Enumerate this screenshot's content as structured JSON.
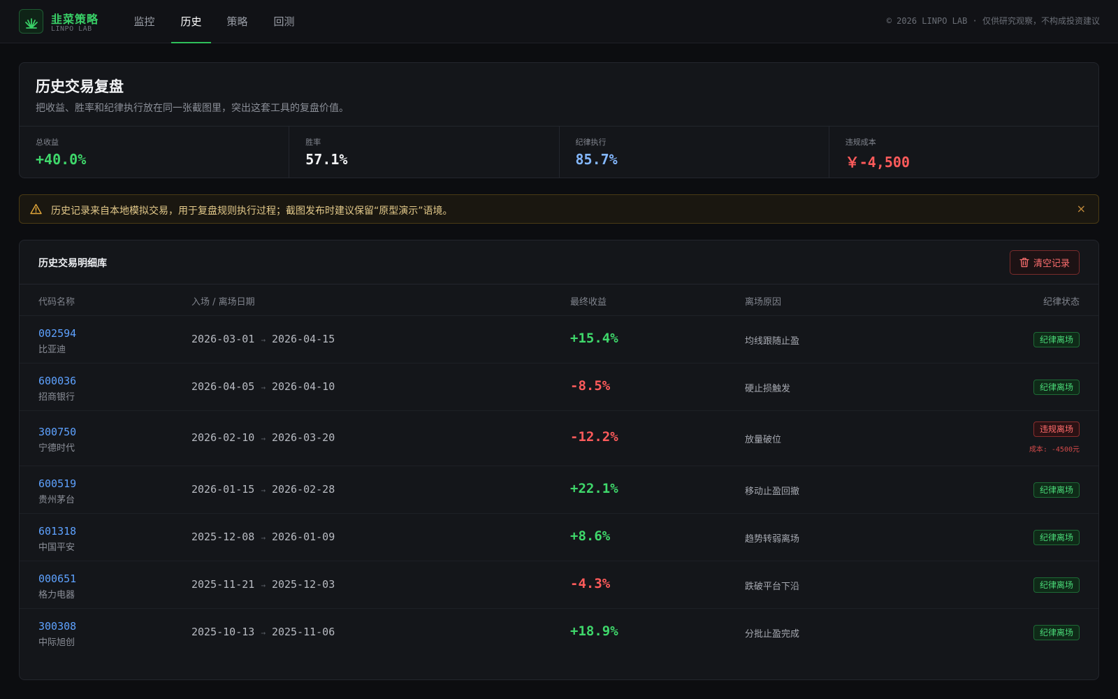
{
  "brand": {
    "name": "韭菜策略",
    "sub": "LINPO LAB"
  },
  "nav": [
    {
      "label": "监控",
      "active": false
    },
    {
      "label": "历史",
      "active": true
    },
    {
      "label": "策略",
      "active": false
    },
    {
      "label": "回测",
      "active": false
    }
  ],
  "top_notice": "© 2026 LINPO LAB · 仅供研究观察，不构成投资建议",
  "summary": {
    "title": "历史交易复盘",
    "desc": "把收益、胜率和纪律执行放在同一张截图里，突出这套工具的复盘价值。",
    "stats": [
      {
        "label": "总收益",
        "value": "+40.0%"
      },
      {
        "label": "胜率",
        "value": "57.1%"
      },
      {
        "label": "纪律执行",
        "value": "85.7%"
      },
      {
        "label": "违规成本",
        "value": "￥-4,500"
      }
    ]
  },
  "warning": {
    "text": "历史记录来自本地模拟交易，用于复盘规则执行过程；截图发布时建议保留“原型演示”语境。",
    "close": "×"
  },
  "table": {
    "title": "历史交易明细库",
    "clear_label": "清空记录",
    "columns": [
      "代码名称",
      "入场 / 离场日期",
      "最终收益",
      "离场原因",
      "纪律状态"
    ],
    "rows": [
      {
        "code": "002594",
        "name": "比亚迪",
        "entry": "2026-03-01",
        "exit": "2026-04-15",
        "pnl": "+15.4%",
        "reason": "均线跟随止盈",
        "status": "纪律离场",
        "status_ok": true,
        "cost": ""
      },
      {
        "code": "600036",
        "name": "招商银行",
        "entry": "2026-04-05",
        "exit": "2026-04-10",
        "pnl": "-8.5%",
        "reason": "硬止损触发",
        "status": "纪律离场",
        "status_ok": true,
        "cost": ""
      },
      {
        "code": "300750",
        "name": "宁德时代",
        "entry": "2026-02-10",
        "exit": "2026-03-20",
        "pnl": "-12.2%",
        "reason": "放量破位",
        "status": "违规离场",
        "status_ok": false,
        "cost": "成本: -4500元"
      },
      {
        "code": "600519",
        "name": "贵州茅台",
        "entry": "2026-01-15",
        "exit": "2026-02-28",
        "pnl": "+22.1%",
        "reason": "移动止盈回撤",
        "status": "纪律离场",
        "status_ok": true,
        "cost": ""
      },
      {
        "code": "601318",
        "name": "中国平安",
        "entry": "2025-12-08",
        "exit": "2026-01-09",
        "pnl": "+8.6%",
        "reason": "趋势转弱离场",
        "status": "纪律离场",
        "status_ok": true,
        "cost": ""
      },
      {
        "code": "000651",
        "name": "格力电器",
        "entry": "2025-11-21",
        "exit": "2025-12-03",
        "pnl": "-4.3%",
        "reason": "跌破平台下沿",
        "status": "纪律离场",
        "status_ok": true,
        "cost": ""
      },
      {
        "code": "300308",
        "name": "中际旭创",
        "entry": "2025-10-13",
        "exit": "2025-11-06",
        "pnl": "+18.9%",
        "reason": "分批止盈完成",
        "status": "纪律离场",
        "status_ok": true,
        "cost": ""
      }
    ]
  },
  "colors": {
    "accent": "#2fbf5a",
    "profit": "#3fd86b",
    "loss": "#ff5b5b",
    "link": "#5ea2ff"
  }
}
